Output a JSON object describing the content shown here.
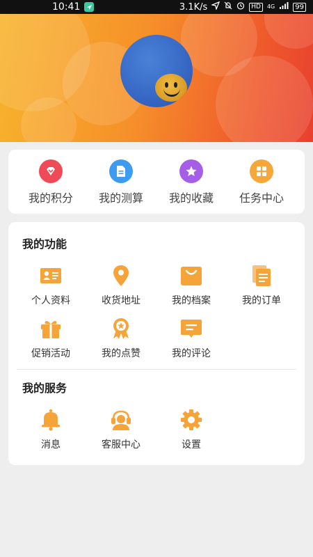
{
  "status_bar": {
    "time": "10:41",
    "speed": "3.1K/s",
    "hd": "HD",
    "network": "4G",
    "battery": "99"
  },
  "quick_actions": [
    {
      "label": "我的积分",
      "icon": "points-icon",
      "color": "#ef4a57"
    },
    {
      "label": "我的测算",
      "icon": "document-icon",
      "color": "#3e9cf0"
    },
    {
      "label": "我的收藏",
      "icon": "star-icon",
      "color": "#a65ee8"
    },
    {
      "label": "任务中心",
      "icon": "grid-icon",
      "color": "#f7a63a"
    }
  ],
  "functions": {
    "title": "我的功能",
    "items": [
      {
        "label": "个人资料",
        "icon": "id-card-icon"
      },
      {
        "label": "收货地址",
        "icon": "location-pin-icon"
      },
      {
        "label": "我的档案",
        "icon": "shopping-bag-icon"
      },
      {
        "label": "我的订单",
        "icon": "documents-icon"
      },
      {
        "label": "促销活动",
        "icon": "gift-icon"
      },
      {
        "label": "我的点赞",
        "icon": "award-ribbon-icon"
      },
      {
        "label": "我的评论",
        "icon": "comment-icon"
      }
    ]
  },
  "services": {
    "title": "我的服务",
    "items": [
      {
        "label": "消息",
        "icon": "bell-icon"
      },
      {
        "label": "客服中心",
        "icon": "headset-icon"
      },
      {
        "label": "设置",
        "icon": "settings-icon"
      }
    ]
  },
  "colors": {
    "accent": "#f5a43a",
    "header_start": "#f7b42c",
    "header_end": "#e8402e",
    "background": "#eeeeee"
  }
}
